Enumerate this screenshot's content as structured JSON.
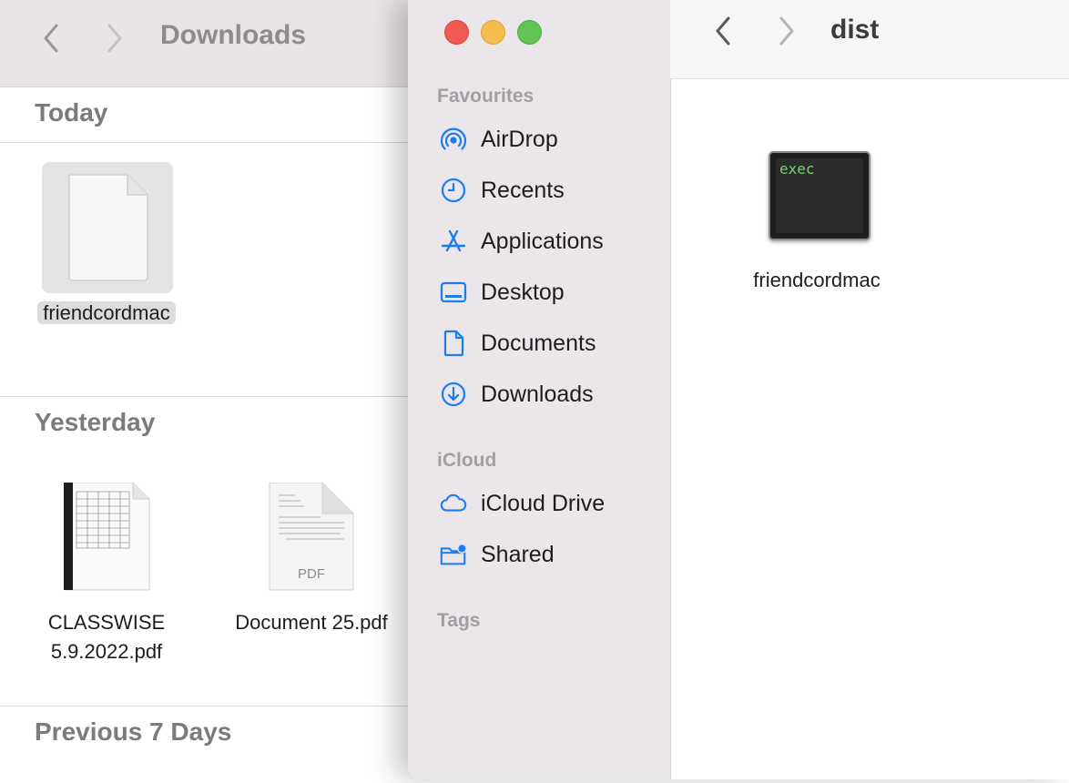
{
  "back_window": {
    "title": "Downloads",
    "sections": {
      "today": "Today",
      "yesterday": "Yesterday",
      "previous": "Previous 7 Days"
    },
    "files": {
      "today_file": "friendcordmac",
      "classwise_line1": "CLASSWISE",
      "classwise_line2": "5.9.2022.pdf",
      "doc25": "Document 25.pdf",
      "doc25_badge": "PDF"
    }
  },
  "sidebar": {
    "favourites_label": "Favourites",
    "items": [
      {
        "label": "AirDrop",
        "icon": "airdrop-icon"
      },
      {
        "label": "Recents",
        "icon": "clock-icon"
      },
      {
        "label": "Applications",
        "icon": "applications-icon"
      },
      {
        "label": "Desktop",
        "icon": "desktop-icon"
      },
      {
        "label": "Documents",
        "icon": "document-icon"
      },
      {
        "label": "Downloads",
        "icon": "download-icon"
      }
    ],
    "icloud_label": "iCloud",
    "icloud_items": [
      {
        "label": "iCloud Drive",
        "icon": "cloud-icon"
      },
      {
        "label": "Shared",
        "icon": "shared-folder-icon"
      }
    ],
    "tags_label": "Tags"
  },
  "front_window": {
    "title": "dist",
    "file_label": "friendcordmac",
    "exec_text": "exec"
  },
  "colors": {
    "accent": "#1a7cf0",
    "close": "#ee5a52",
    "minimize": "#f5bd4f",
    "zoom": "#61c454"
  }
}
